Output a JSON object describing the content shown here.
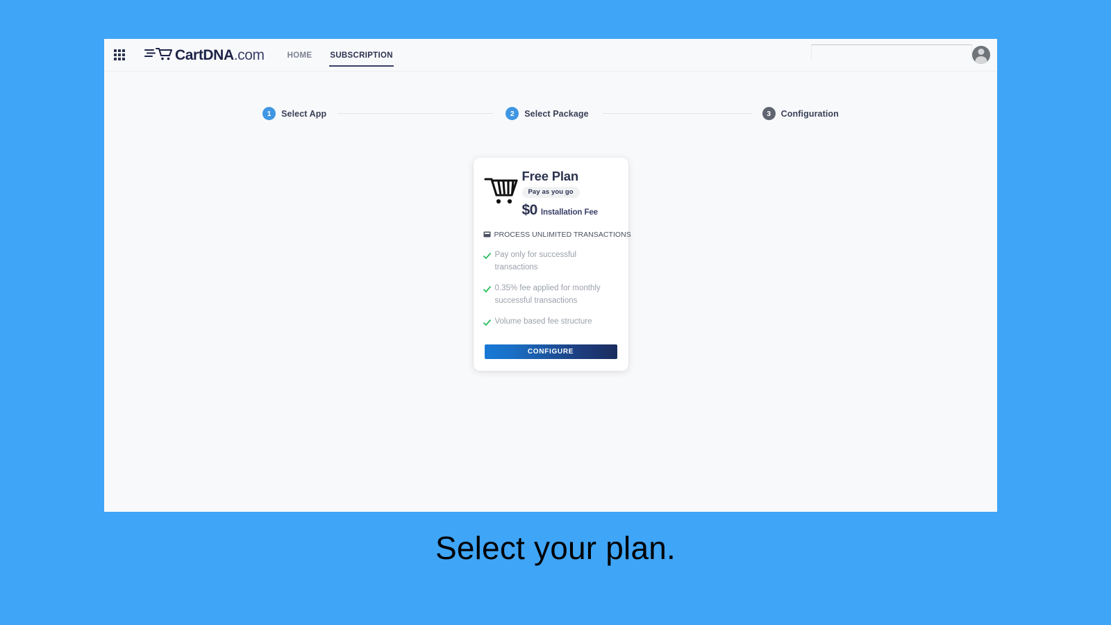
{
  "page": {
    "background_color": "#3fa5f7",
    "caption": "Select your plan."
  },
  "header": {
    "grid_icon": "apps-grid-icon",
    "brand": {
      "name": "CartDNA",
      "tld": ".com",
      "logo_icon": "cart-speed-logo-icon"
    },
    "nav": [
      {
        "label": "HOME",
        "active": false
      },
      {
        "label": "SUBSCRIPTION",
        "active": true
      }
    ],
    "search": {
      "value": "",
      "placeholder": ""
    },
    "avatar": "user-avatar-icon"
  },
  "stepper": {
    "steps": [
      {
        "number": "1",
        "label": "Select App",
        "state": "done"
      },
      {
        "number": "2",
        "label": "Select Package",
        "state": "done"
      },
      {
        "number": "3",
        "label": "Configuration",
        "state": "todo"
      }
    ],
    "colors": {
      "done": "#3f97e3",
      "todo": "#5f6570",
      "line": "#e3e5e8"
    }
  },
  "plan_card": {
    "icon": "shopping-cart-icon",
    "title": "Free Plan",
    "badge": "Pay as you go",
    "price": "$0",
    "price_note": "Installation Fee",
    "subhead_icon": "transaction-card-icon",
    "subhead": "PROCESS UNLIMITED TRANSACTIONS",
    "features": [
      "Pay only for successful transactions",
      "0.35% fee applied for monthly successful transactions",
      "Volume based fee structure"
    ],
    "check_color": "#2fbf61",
    "cta_label": "CONFIGURE",
    "cta_gradient_from": "#1779d6",
    "cta_gradient_to": "#1b2c5e"
  }
}
